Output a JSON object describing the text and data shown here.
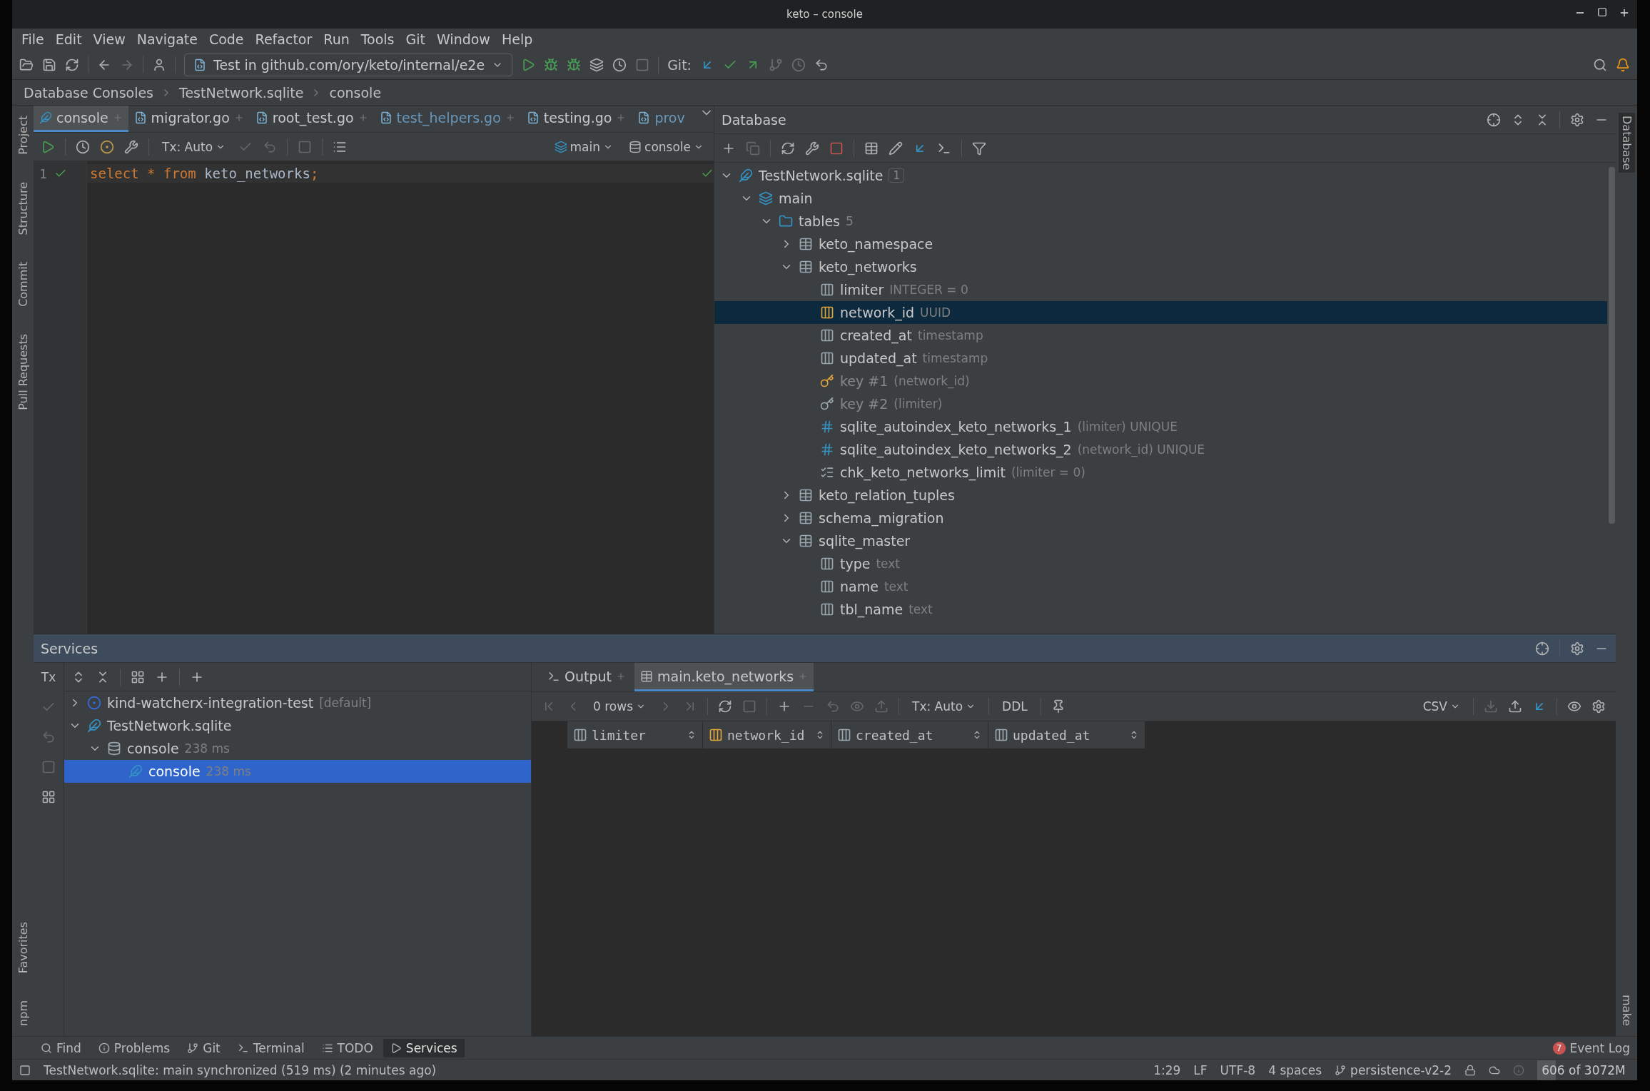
{
  "window": {
    "title": "keto – console"
  },
  "menu": [
    "File",
    "Edit",
    "View",
    "Navigate",
    "Code",
    "Refactor",
    "Run",
    "Tools",
    "Git",
    "Window",
    "Help"
  ],
  "toolbar": {
    "run_config": "Test in github.com/ory/keto/internal/e2e",
    "git_label": "Git:"
  },
  "breadcrumbs": [
    "Database Consoles",
    "TestNetwork.sqlite",
    "console"
  ],
  "left_strip_top": [
    "Project",
    "Structure",
    "Commit",
    "Pull Requests"
  ],
  "left_strip_bottom": [
    "Favorites",
    "npm"
  ],
  "right_strip": [
    "Database",
    "make"
  ],
  "editor_tabs": [
    {
      "label": "console",
      "selected": true,
      "kind": "console"
    },
    {
      "label": "migrator.go",
      "selected": false,
      "kind": "go"
    },
    {
      "label": "root_test.go",
      "selected": false,
      "kind": "go"
    },
    {
      "label": "test_helpers.go",
      "selected": false,
      "kind": "go-modified"
    },
    {
      "label": "testing.go",
      "selected": false,
      "kind": "go"
    },
    {
      "label": "prov",
      "selected": false,
      "kind": "go-modified"
    }
  ],
  "editor_toolbar": {
    "tx": "Tx: Auto",
    "schema": "main",
    "session": "console"
  },
  "editor": {
    "lines": [
      {
        "number": "1",
        "tokens": [
          {
            "text": "select * from ",
            "kind": "keyword"
          },
          {
            "text": "keto_networks",
            "kind": "identifier"
          },
          {
            "text": ";",
            "kind": "keyword"
          }
        ]
      }
    ]
  },
  "database": {
    "title": "Database",
    "tree": [
      {
        "label": "TestNetwork.sqlite",
        "badge": "1",
        "kind": "database",
        "expanded": true,
        "selected": false,
        "children": [
          {
            "label": "main",
            "kind": "schema",
            "expanded": true,
            "selected": false,
            "children": [
              {
                "label": "tables",
                "detail": "5",
                "kind": "folder",
                "expanded": true,
                "selected": false,
                "children": [
                  {
                    "label": "keto_namespace",
                    "kind": "table",
                    "expanded": false,
                    "selected": false
                  },
                  {
                    "label": "keto_networks",
                    "kind": "table",
                    "expanded": true,
                    "selected": false,
                    "children": [
                      {
                        "label": "limiter",
                        "detail": "INTEGER = 0",
                        "kind": "column",
                        "selected": false
                      },
                      {
                        "label": "network_id",
                        "detail": "UUID",
                        "kind": "pk-column",
                        "selected": true
                      },
                      {
                        "label": "created_at",
                        "detail": "timestamp",
                        "kind": "column",
                        "selected": false
                      },
                      {
                        "label": "updated_at",
                        "detail": "timestamp",
                        "kind": "column",
                        "selected": false
                      },
                      {
                        "label": "key #1",
                        "detail": "(network_id)",
                        "kind": "primary-key",
                        "selected": false
                      },
                      {
                        "label": "key #2",
                        "detail": "(limiter)",
                        "kind": "key",
                        "selected": false
                      },
                      {
                        "label": "sqlite_autoindex_keto_networks_1",
                        "detail": "(limiter) UNIQUE",
                        "kind": "index",
                        "selected": false
                      },
                      {
                        "label": "sqlite_autoindex_keto_networks_2",
                        "detail": "(network_id) UNIQUE",
                        "kind": "index",
                        "selected": false
                      },
                      {
                        "label": "chk_keto_networks_limit",
                        "detail": "(limiter = 0)",
                        "kind": "check",
                        "selected": false
                      }
                    ]
                  },
                  {
                    "label": "keto_relation_tuples",
                    "kind": "table",
                    "expanded": false,
                    "selected": false
                  },
                  {
                    "label": "schema_migration",
                    "kind": "table",
                    "expanded": false,
                    "selected": false
                  },
                  {
                    "label": "sqlite_master",
                    "kind": "table",
                    "expanded": true,
                    "selected": false,
                    "children": [
                      {
                        "label": "type",
                        "detail": "text",
                        "kind": "column",
                        "selected": false
                      },
                      {
                        "label": "name",
                        "detail": "text",
                        "kind": "column",
                        "selected": false
                      },
                      {
                        "label": "tbl_name",
                        "detail": "text",
                        "kind": "column",
                        "selected": false
                      }
                    ]
                  }
                ]
              }
            ]
          }
        ]
      }
    ]
  },
  "services": {
    "title": "Services",
    "tx_label": "Tx",
    "tree": [
      {
        "label": "kind-watcherx-integration-test",
        "detail": "[default]",
        "kind": "kubernetes",
        "expanded": false,
        "selected": false
      },
      {
        "label": "TestNetwork.sqlite",
        "kind": "database",
        "expanded": true,
        "selected": false,
        "children": [
          {
            "label": "console",
            "detail": "238 ms",
            "kind": "session",
            "expanded": true,
            "selected": false,
            "children": [
              {
                "label": "console",
                "detail": "238 ms",
                "kind": "console",
                "selected": true
              }
            ]
          }
        ]
      }
    ]
  },
  "result_tabs": [
    {
      "label": "Output",
      "kind": "output",
      "selected": false
    },
    {
      "label": "main.keto_networks",
      "kind": "table",
      "selected": true
    }
  ],
  "result_toolbar": {
    "rows": "0 rows",
    "tx": "Tx: Auto",
    "ddl": "DDL",
    "format": "CSV"
  },
  "result_columns": [
    {
      "label": "limiter",
      "kind": "column"
    },
    {
      "label": "network_id",
      "kind": "pk-column"
    },
    {
      "label": "created_at",
      "kind": "column"
    },
    {
      "label": "updated_at",
      "kind": "column"
    }
  ],
  "bottom_tabs": [
    {
      "label": "Find",
      "kind": "find",
      "selected": false
    },
    {
      "label": "Problems",
      "kind": "problems",
      "selected": false
    },
    {
      "label": "Git",
      "kind": "git",
      "selected": false
    },
    {
      "label": "Terminal",
      "kind": "terminal",
      "selected": false
    },
    {
      "label": "TODO",
      "kind": "todo",
      "selected": false
    },
    {
      "label": "Services",
      "kind": "services",
      "selected": true
    }
  ],
  "event_log": {
    "count": "7",
    "label": "Event Log"
  },
  "status_bar": {
    "message": "TestNetwork.sqlite: main synchronized (519 ms) (2 minutes ago)",
    "items": [
      "1:29",
      "LF",
      "UTF-8",
      "4 spaces"
    ],
    "branch": "persistence-v2-2",
    "memory": {
      "text": "606 of 3072M",
      "level": 0.2
    }
  }
}
